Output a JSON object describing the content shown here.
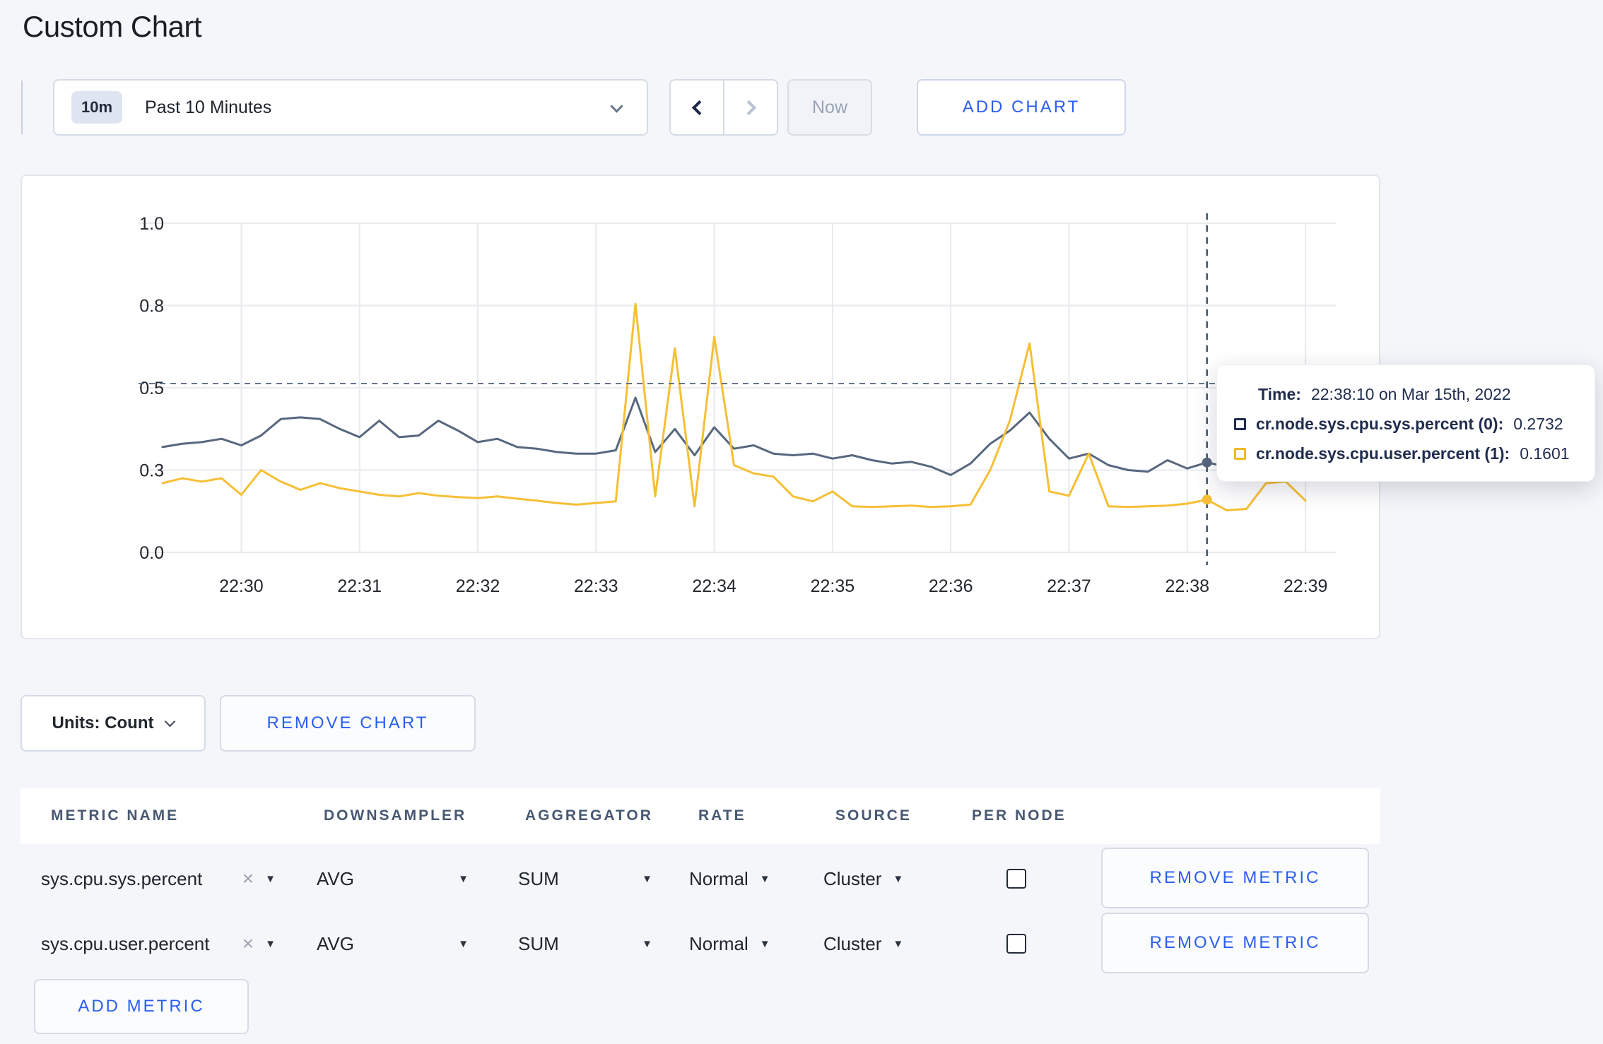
{
  "page": {
    "title": "Custom Chart"
  },
  "toolbar": {
    "time_badge": "10m",
    "time_label": "Past 10 Minutes",
    "now_label": "Now",
    "add_chart_label": "ADD CHART"
  },
  "icons": {
    "caret_down": "▼",
    "close": "×"
  },
  "chart_data": {
    "type": "line",
    "title": "",
    "xlabel": "",
    "ylabel": "",
    "ylim": [
      0,
      1
    ],
    "grid": true,
    "x_ticks": [
      "22:30",
      "22:31",
      "22:32",
      "22:33",
      "22:34",
      "22:35",
      "22:36",
      "22:37",
      "22:38",
      "22:39"
    ],
    "y_ticks": {
      "values": [
        0,
        0.25,
        0.5,
        0.75,
        1.0
      ],
      "labels": [
        "0.0",
        "0.3",
        "0.5",
        "0.8",
        "1.0"
      ]
    },
    "start_time": "22:29:20",
    "interval_seconds": 10,
    "first_point_offset_seconds": -40,
    "series": [
      {
        "name": "cr.node.sys.cpu.sys.percent (0)",
        "color": "#58677f",
        "values": [
          0.32,
          0.33,
          0.335,
          0.345,
          0.325,
          0.355,
          0.405,
          0.41,
          0.405,
          0.375,
          0.35,
          0.4,
          0.35,
          0.355,
          0.4,
          0.37,
          0.335,
          0.345,
          0.32,
          0.315,
          0.305,
          0.3,
          0.3,
          0.31,
          0.47,
          0.305,
          0.375,
          0.295,
          0.38,
          0.315,
          0.325,
          0.3,
          0.295,
          0.3,
          0.285,
          0.295,
          0.28,
          0.27,
          0.275,
          0.26,
          0.235,
          0.27,
          0.33,
          0.37,
          0.425,
          0.345,
          0.285,
          0.3,
          0.265,
          0.25,
          0.245,
          0.28,
          0.255,
          0.2732,
          0.26,
          0.27,
          0.28,
          0.285,
          0.29
        ]
      },
      {
        "name": "cr.node.sys.cpu.user.percent (1)",
        "color": "#f6bf35",
        "values": [
          0.21,
          0.225,
          0.215,
          0.225,
          0.175,
          0.25,
          0.215,
          0.19,
          0.21,
          0.195,
          0.185,
          0.175,
          0.17,
          0.18,
          0.172,
          0.168,
          0.165,
          0.17,
          0.163,
          0.157,
          0.15,
          0.145,
          0.15,
          0.155,
          0.755,
          0.17,
          0.62,
          0.14,
          0.655,
          0.265,
          0.24,
          0.23,
          0.17,
          0.155,
          0.185,
          0.14,
          0.138,
          0.14,
          0.142,
          0.138,
          0.14,
          0.145,
          0.25,
          0.4,
          0.635,
          0.185,
          0.172,
          0.3,
          0.14,
          0.138,
          0.14,
          0.142,
          0.148,
          0.1601,
          0.128,
          0.132,
          0.21,
          0.215,
          0.157
        ]
      }
    ],
    "hover": {
      "time_index": 53,
      "time": "22:38:10",
      "crosshair_y_value": 0.513
    }
  },
  "tooltip": {
    "time_label": "Time:",
    "time_value": "22:38:10 on Mar 15th, 2022",
    "entries": [
      {
        "label": "cr.node.sys.cpu.sys.percent (0):",
        "value": "0.2732",
        "color": "#1b2a4e"
      },
      {
        "label": "cr.node.sys.cpu.user.percent (1):",
        "value": "0.1601",
        "color": "#f2b824"
      }
    ]
  },
  "chart_controls": {
    "units_label": "Units: Count",
    "remove_chart_label": "REMOVE CHART"
  },
  "metrics_table": {
    "headers": [
      "METRIC NAME",
      "DOWNSAMPLER",
      "AGGREGATOR",
      "RATE",
      "SOURCE",
      "PER NODE"
    ],
    "rows": [
      {
        "metric": "sys.cpu.sys.percent",
        "downsampler": "AVG",
        "aggregator": "SUM",
        "rate": "Normal",
        "source": "Cluster",
        "per_node": false
      },
      {
        "metric": "sys.cpu.user.percent",
        "downsampler": "AVG",
        "aggregator": "SUM",
        "rate": "Normal",
        "source": "Cluster",
        "per_node": false
      }
    ],
    "remove_metric_label": "REMOVE METRIC",
    "add_metric_label": "ADD METRIC"
  },
  "colors": {
    "accent_blue": "#2b5df2",
    "series_sys": "#58677f",
    "series_user": "#f6bf35",
    "crosshair": "#41506a",
    "grid": "#e8eaef",
    "page_bg": "#f4f6fa"
  }
}
